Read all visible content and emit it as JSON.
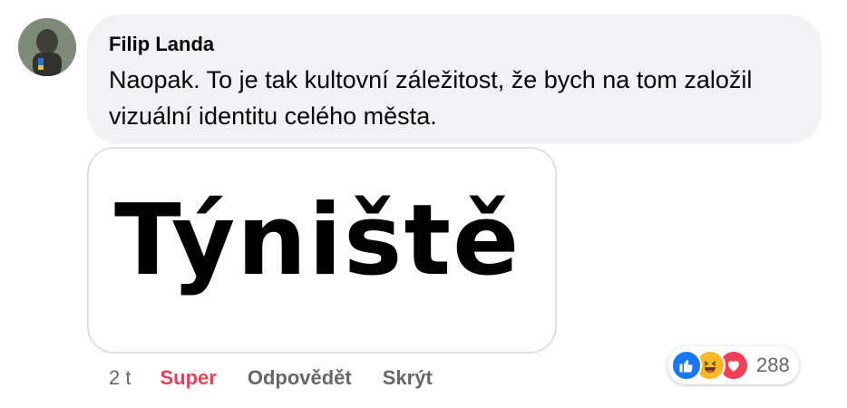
{
  "comment": {
    "author": "Filip Landa",
    "text": "Naopak. To je tak kultovní záležitost, že bych na tom založil vizuální identitu celého města.",
    "attachment_text": "Týniště"
  },
  "actions": {
    "time": "2 t",
    "like_label": "Super",
    "reply_label": "Odpovědět",
    "hide_label": "Skrýt"
  },
  "reactions": {
    "icons": [
      "like-icon",
      "haha-icon",
      "love-icon"
    ],
    "count": "288",
    "colors": {
      "like": "#1877f2",
      "haha": "#f7b928",
      "love": "#f33e58",
      "accent": "#e4415a"
    }
  }
}
